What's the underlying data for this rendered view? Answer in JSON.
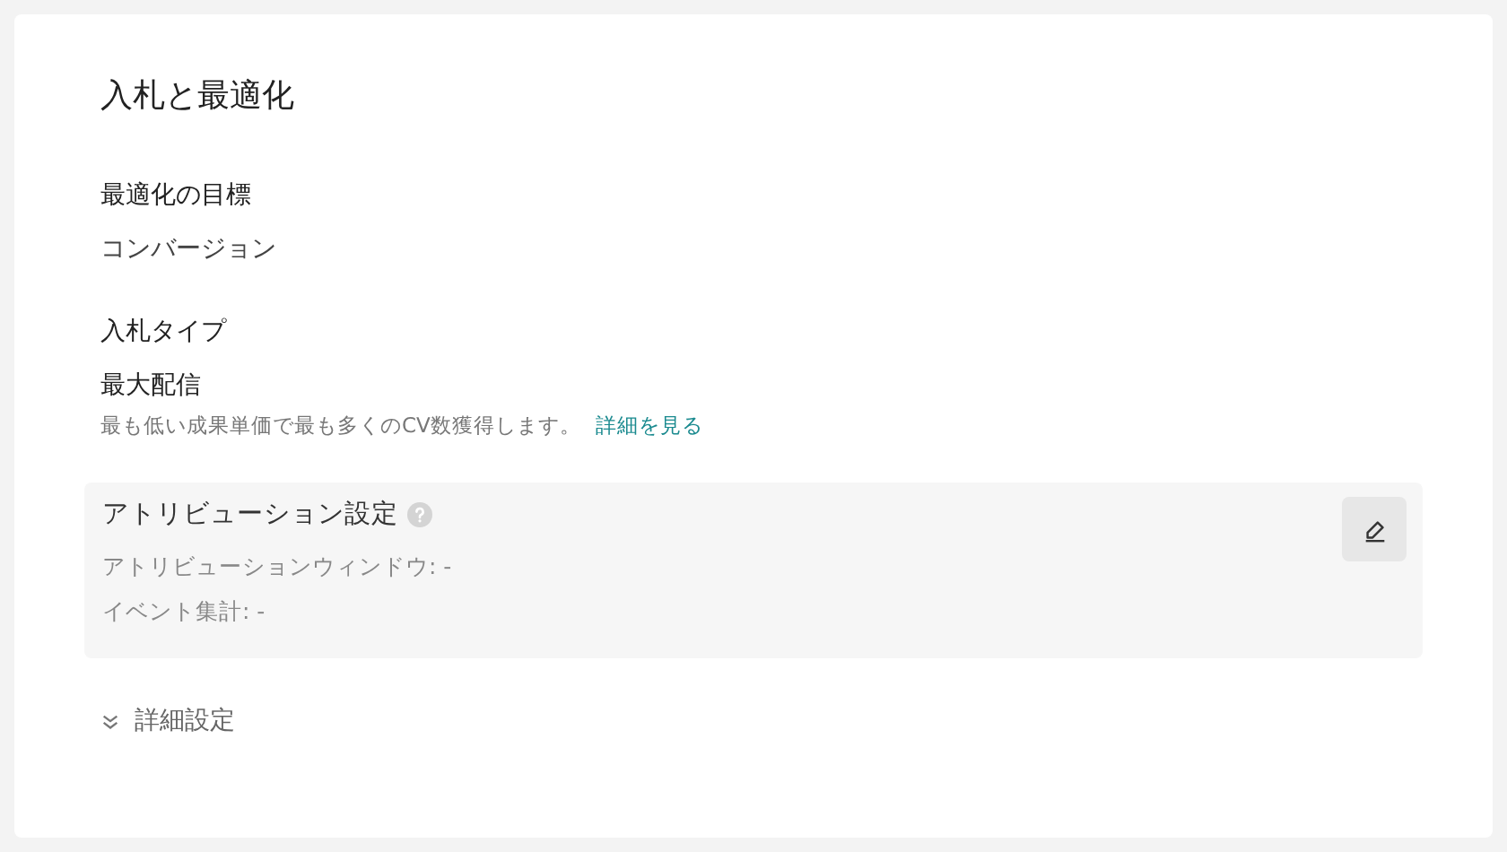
{
  "title": "入札と最適化",
  "optimization_goal": {
    "label": "最適化の目標",
    "value": "コンバージョン"
  },
  "bid_type": {
    "label": "入札タイプ",
    "value": "最大配信",
    "description": "最も低い成果単価で最も多くのCV数獲得します。",
    "link": "詳細を見る"
  },
  "attribution": {
    "title": "アトリビューション設定",
    "rows": [
      "アトリビューションウィンドウ: -",
      "イベント集計: -"
    ]
  },
  "advanced": {
    "label": "詳細設定",
    "expanded": false
  }
}
